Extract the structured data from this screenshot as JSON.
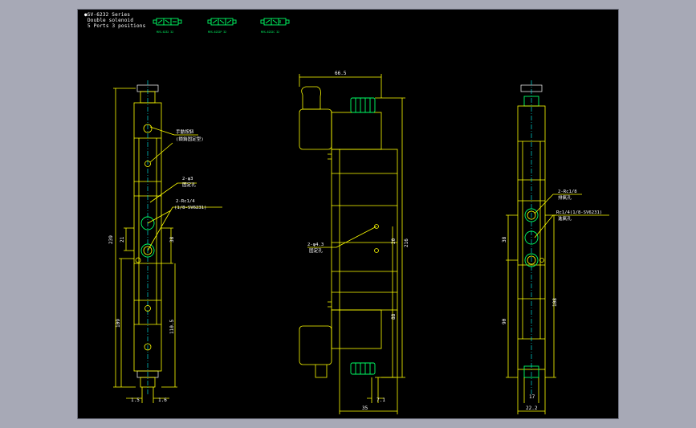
{
  "header": {
    "series": "●SV-6232 Series",
    "line2": "Double solenoid",
    "line3": "5 Ports 3 positions"
  },
  "symbols": [
    {
      "caption": "MVS-6232 32"
    },
    {
      "caption": "MVS-6232P 32"
    },
    {
      "caption": "MVS-6232C 32"
    }
  ],
  "left_view": {
    "dims": {
      "overall": "239",
      "d21": "21",
      "d38": "38",
      "d109": "109",
      "d1105": "110.5",
      "d15": "1.5",
      "d16": "1.6"
    },
    "notes": {
      "manual_a": "手動按鈕",
      "manual_b": "(鎖銷固定型)",
      "mount_a": "2-φ3",
      "mount_b": "固定孔",
      "port_a": "2-Rc1/4",
      "port_b": "(1/8-SV6231)"
    }
  },
  "middle_view": {
    "dims": {
      "top": "66.5",
      "d216": "216",
      "d20": "20",
      "d88": "88",
      "d71": "7.1",
      "d35": "35"
    },
    "notes": {
      "mount_a": "2-φ4.3",
      "mount_b": "固定孔"
    }
  },
  "right_view": {
    "dims": {
      "d38": "38",
      "d108": "108",
      "d90": "90",
      "d17": "17",
      "d222": "22.2"
    },
    "notes": {
      "exh_a": "2-Rc1/8",
      "exh_b": "排氣孔",
      "inlet_a": "Rc1/4(1/8-SV6231)",
      "inlet_b": "進氣孔"
    }
  }
}
